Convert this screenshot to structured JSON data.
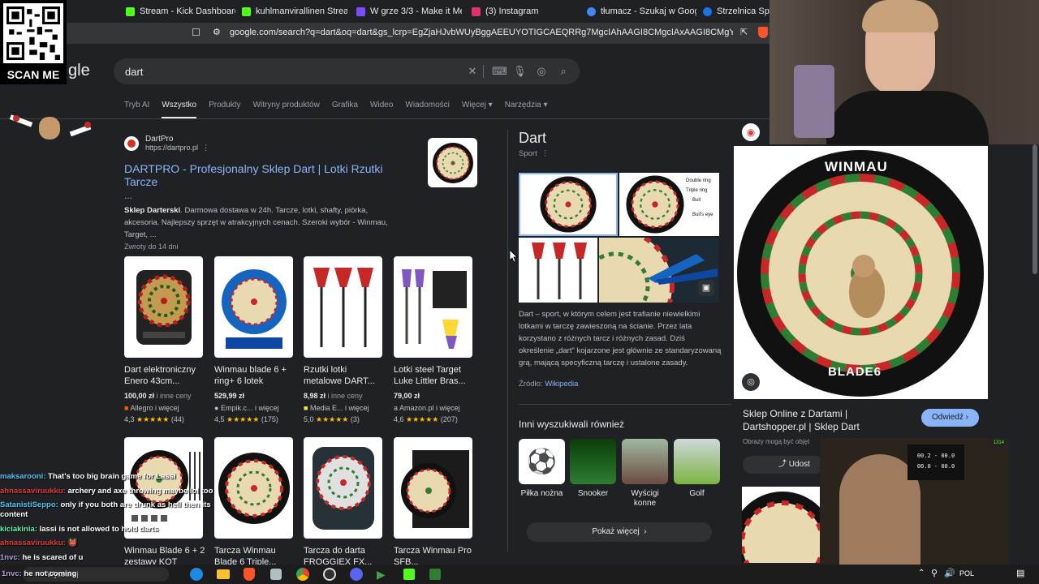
{
  "tabs": [
    {
      "label": "Stream - Kick Dashboard",
      "color": "#53fc18"
    },
    {
      "label": "kuhlmanvirallinen Stream",
      "color": "#53fc18"
    },
    {
      "label": "W grze 3/3 - Make it Meme",
      "color": "#7c4dff"
    },
    {
      "label": "(3) Instagram",
      "color": "#e1306c"
    },
    {
      "label": "tłumacz - Szukaj w Google",
      "color": "#4285f4"
    },
    {
      "label": "Strzelnica Sportowa",
      "color": "#1a73e8"
    }
  ],
  "url": "google.com/search?q=dart&oq=dart&gs_lcrp=EgZjaHJvbWUyBggAEEUYOTIGCAEQRRg7MgcIAhAAGI8CMgcIAxAAGI8CMgYIBBBFGD0yBggFEEUYPTI...",
  "overlay": {
    "scan_label": "SCAN ME"
  },
  "search": {
    "logo_fragment": "gle",
    "query": "dart"
  },
  "nav_tabs": [
    "Tryb AI",
    "Wszystko",
    "Produkty",
    "Witryny produktów",
    "Grafika",
    "Wideo",
    "Wiadomości",
    "Więcej",
    "Narzędzia"
  ],
  "result": {
    "site_name": "DartPro",
    "site_url": "https://dartpro.pl",
    "title": "DARTPRO - Profesjonalny Sklep Dart | Lotki Rzutki Tarcze",
    "ellipsis": "...",
    "snippet_bold": "Sklep Darterski",
    "snippet": ". Darmowa dostawa w 24h. Tarcze, lotki, shafty, piórka, akcesoria. Najlepszy sprzęt w atrakcyjnych cenach. Szeroki wybór - Winmau, Target, ...",
    "returns": "Zwroty do 14 dni"
  },
  "products": [
    {
      "title": "Dart elektroniczny Enero 43cm...",
      "price": "100,00 zł",
      "extra": " i inne ceny",
      "seller": "Allegro i więcej",
      "rating": "4,3",
      "stars": "★★★★★",
      "reviews": "(44)"
    },
    {
      "title": "Winmau blade 6 + ring+ 6 lotek",
      "price": "529,99 zł",
      "extra": "",
      "seller": "Empik.c... i więcej",
      "rating": "4,5",
      "stars": "★★★★★",
      "reviews": "(175)"
    },
    {
      "title": "Rzutki lotki metalowe DART...",
      "price": "8,98 zł",
      "extra": " i inne ceny",
      "seller": "Media E... i więcej",
      "rating": "5,0",
      "stars": "★★★★★",
      "reviews": "(3)"
    },
    {
      "title": "Lotki steel Target Luke Littler Bras...",
      "price": "79,00 zł",
      "extra": "",
      "seller": "Amazon.pl i więcej",
      "rating": "4,6",
      "stars": "★★★★★",
      "reviews": "(207)"
    },
    {
      "title": "Winmau Blade 6 + 2 zestawy KOT",
      "price": "",
      "extra": "",
      "seller": "",
      "rating": "",
      "stars": "",
      "reviews": ""
    },
    {
      "title": "Tarcza Winmau Blade 6 Triple...",
      "price": "",
      "extra": "",
      "seller": "",
      "rating": "",
      "stars": "",
      "reviews": ""
    },
    {
      "title": "Tarcza do darta FROGGIEX FX...",
      "price": "",
      "extra": "",
      "seller": "",
      "rating": "",
      "stars": "",
      "reviews": ""
    },
    {
      "title": "Tarcza Winmau Pro SFB...",
      "price": "",
      "extra": "",
      "seller": "",
      "rating": "",
      "stars": "",
      "reviews": ""
    }
  ],
  "knowledge": {
    "title": "Dart",
    "subtitle": "Sport",
    "diagram_labels": [
      "Double ring",
      "Triple ring",
      "Bull",
      "Bull's eye"
    ],
    "description": "Dart – sport, w którym celem jest trafianie niewielkimi lotkami w tarczę zawieszoną na ścianie. Przez lata korzystano z różnych tarcz i różnych zasad. Dziś określenie „dart\" kojarzone jest głównie ze standaryzowaną grą, mającą specyficzną tarczę i ustalone zasady.",
    "source_label": "Źródło:",
    "source_link": "Wikipedia",
    "related_heading": "Inni wyszukiwali również",
    "related": [
      "Piłka nożna",
      "Snooker",
      "Wyścigi konne",
      "Golf"
    ],
    "show_more": "Pokaż więcej"
  },
  "preview": {
    "board_brand": "WINMAU",
    "board_model": "BLADE6",
    "title": "Sklep Online z Dartami | Dartshopper.pl | Sklep Dart",
    "visit": "Odwiedź",
    "notice": "Obrazy mogą być objęt",
    "share": "Udost"
  },
  "webcam": {
    "score_line1": "00.2 - 00.0",
    "score_line2": "00.0 - 00.0",
    "viewer_badge": "1314"
  },
  "chat": [
    {
      "user": "maksarooni:",
      "color": "#4fc3f7",
      "msg": "That's too big brain game for Lassi"
    },
    {
      "user": "ahnassaviruukku:",
      "color": "#e53935",
      "msg": "archery and axe throwing maybe lol too"
    },
    {
      "user": "SatanistiSeppo:",
      "color": "#4fc3f7",
      "msg": "only if you both are drunk as hell then its content"
    },
    {
      "user": "kiciakinia:",
      "color": "#69f0ae",
      "msg": "lassi is not allowed to hold darts"
    },
    {
      "user": "ahnassaviruukku:",
      "color": "#e53935",
      "msg": "👹"
    },
    {
      "user": "1nvc:",
      "color": "#b39ddb",
      "msg": "he is scared of u"
    },
    {
      "user": "1nvc:",
      "color": "#b39ddb",
      "msg": "he not coming"
    }
  ],
  "taskbar": {
    "search_placeholder": "Wyszukaj",
    "lang": "POL"
  }
}
